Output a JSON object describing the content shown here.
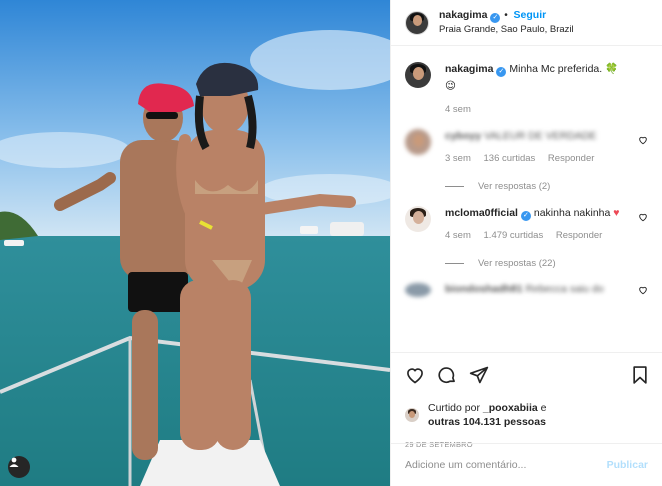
{
  "post": {
    "username": "nakagima",
    "verified_badge": "✓",
    "follow_dot": "•",
    "follow_label": "Seguir",
    "location": "Praia Grande, Sao Paulo, Brazil"
  },
  "photo": {
    "description_icon": "user-tag-icon"
  },
  "comments": [
    {
      "username": "nakagima",
      "text": "Minha Mc preferida. 🍀",
      "emoji2": "😉",
      "time": "4 sem"
    },
    {
      "username": "cyboyy",
      "text": "VALEUR DE VERDADE",
      "blurred": true,
      "time": "3 sem",
      "likes": "136 curtidas",
      "reply": "Responder",
      "view_replies": "Ver respostas (2)"
    },
    {
      "username": "mcloma0fficial",
      "text": "nakinha nakinha",
      "heart": "♥",
      "time": "4 sem",
      "likes": "1.479 curtidas",
      "reply": "Responder",
      "view_replies": "Ver respostas (22)"
    },
    {
      "username": "biondoshadh81",
      "text": "Rebecca saiu do",
      "blurred": true
    }
  ],
  "likes": {
    "prefix": "Curtido por",
    "first_user": "_pooxabiia",
    "joiner": "e",
    "others": "outras 104.131 pessoas"
  },
  "date": "29 DE SETEMBRO",
  "add_comment": {
    "placeholder": "Adicione um comentário...",
    "publish_label": "Publicar"
  },
  "icons": [
    "heart-icon",
    "comment-icon",
    "share-icon",
    "save-icon",
    "verified-icon",
    "user-tag-icon"
  ],
  "colors": {
    "link_blue": "#0095f6",
    "verified_blue": "#3897f0",
    "publish_disabled": "#b2dffc",
    "meta_gray": "#8e8e8e",
    "heart_red": "#ed4956"
  }
}
